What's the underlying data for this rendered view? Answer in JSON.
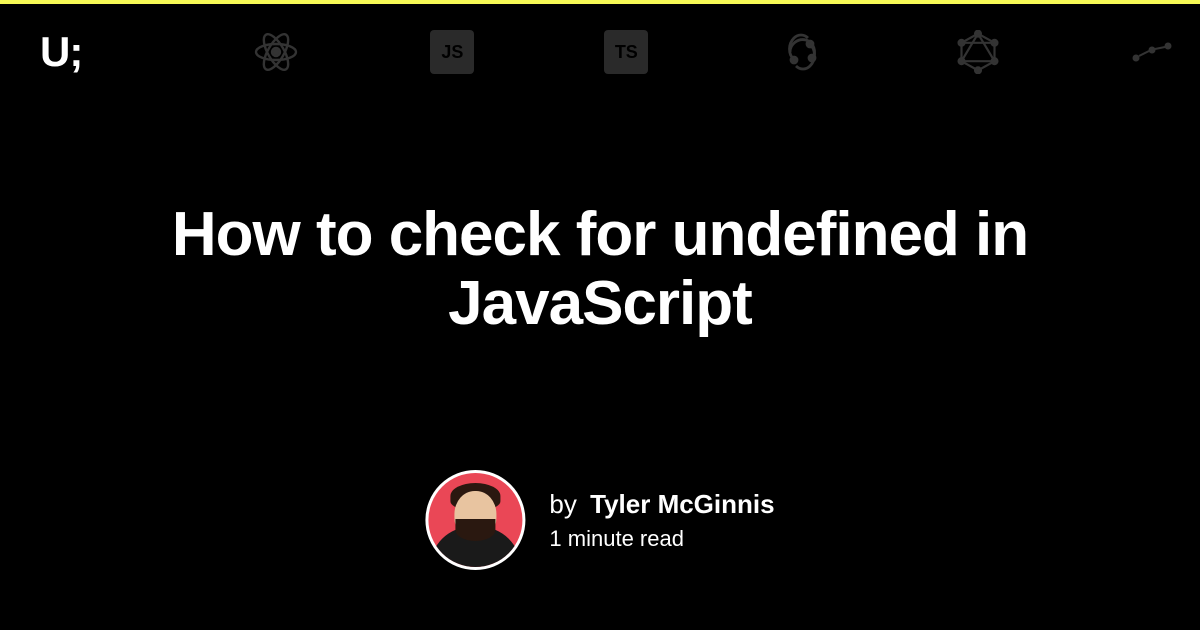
{
  "brand": {
    "logo_text": "U;"
  },
  "nav": {
    "icons": [
      {
        "name": "react-icon"
      },
      {
        "name": "javascript-icon",
        "label": "JS"
      },
      {
        "name": "typescript-icon",
        "label": "TS"
      },
      {
        "name": "redux-icon"
      },
      {
        "name": "graphql-icon"
      },
      {
        "name": "dots-icon"
      }
    ]
  },
  "article": {
    "title": "How to check for undefined in JavaScript",
    "byline_prefix": "by",
    "author_name": "Tyler McGinnis",
    "read_time": "1 minute read"
  }
}
